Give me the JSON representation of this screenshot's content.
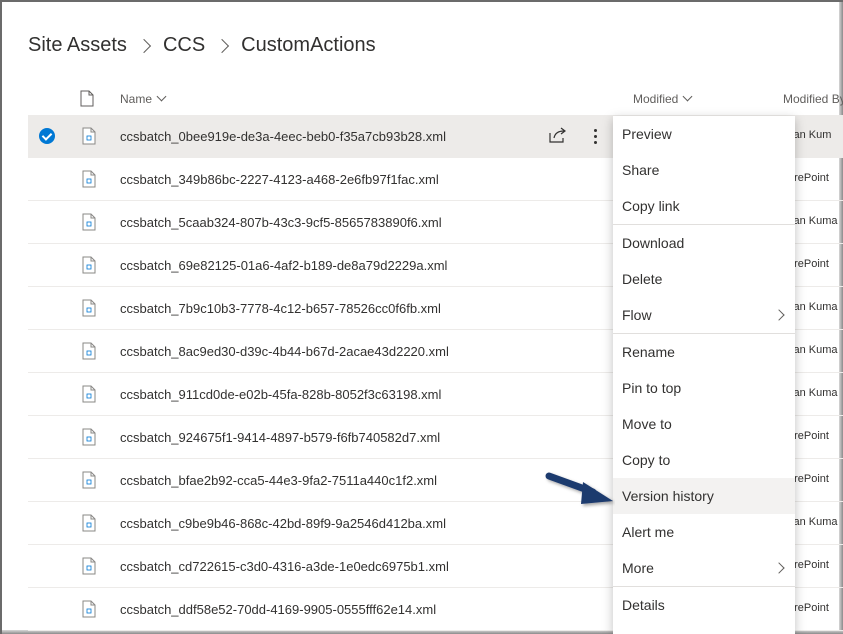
{
  "breadcrumb": [
    "Site Assets",
    "CCS",
    "CustomActions"
  ],
  "columns": {
    "name": "Name",
    "modified": "Modified",
    "modified_by": "Modified By"
  },
  "files": [
    {
      "name": "ccsbatch_0bee919e-de3a-4eec-beb0-f35a7cb93b28.xml",
      "modified_by": "van Kum",
      "selected": true
    },
    {
      "name": "ccsbatch_349b86bc-2227-4123-a468-2e6fb97f1fac.xml",
      "modified_by": "arePoint"
    },
    {
      "name": "ccsbatch_5caab324-807b-43c3-9cf5-8565783890f6.xml",
      "modified_by": "van Kuma"
    },
    {
      "name": "ccsbatch_69e82125-01a6-4af2-b189-de8a79d2229a.xml",
      "modified_by": "arePoint"
    },
    {
      "name": "ccsbatch_7b9c10b3-7778-4c12-b657-78526cc0f6fb.xml",
      "modified_by": "van Kuma"
    },
    {
      "name": "ccsbatch_8ac9ed30-d39c-4b44-b67d-2acae43d2220.xml",
      "modified_by": "van Kuma"
    },
    {
      "name": "ccsbatch_911cd0de-e02b-45fa-828b-8052f3c63198.xml",
      "modified_by": "van Kuma"
    },
    {
      "name": "ccsbatch_924675f1-9414-4897-b579-f6fb740582d7.xml",
      "modified_by": "arePoint"
    },
    {
      "name": "ccsbatch_bfae2b92-cca5-44e3-9fa2-7511a440c1f2.xml",
      "modified_by": "arePoint"
    },
    {
      "name": "ccsbatch_c9be9b46-868c-42bd-89f9-9a2546d412ba.xml",
      "modified_by": "van Kuma"
    },
    {
      "name": "ccsbatch_cd722615-c3d0-4316-a3de-1e0edc6975b1.xml",
      "modified_by": "arePoint"
    },
    {
      "name": "ccsbatch_ddf58e52-70dd-4169-9905-0555fff62e14.xml",
      "modified_by": "arePoint"
    }
  ],
  "menu": {
    "groups": [
      [
        "Preview",
        "Share",
        "Copy link"
      ],
      [
        "Download",
        "Delete",
        "Flow"
      ],
      [
        "Rename",
        "Pin to top",
        "Move to",
        "Copy to",
        "Version history",
        "Alert me",
        "More"
      ],
      [
        "Details"
      ]
    ],
    "submenu_items": [
      "Flow",
      "More"
    ],
    "highlighted": "Version history"
  },
  "colors": {
    "accent": "#0078d4",
    "arrow": "#1f3a6e",
    "selected_row": "#edebe9"
  },
  "icons": {
    "file": "file-xml-icon",
    "share": "share-icon",
    "more": "more-vertical-icon",
    "header_file": "document-icon"
  }
}
